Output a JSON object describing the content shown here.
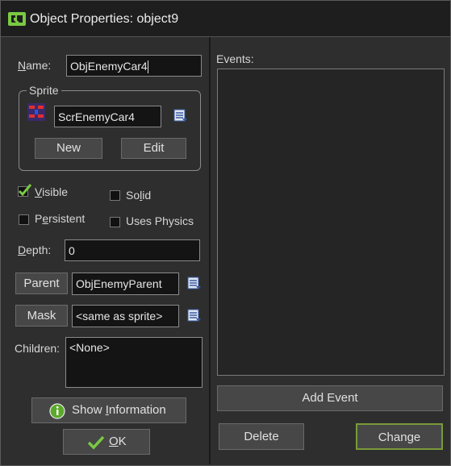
{
  "window": {
    "title": "Object Properties: object9"
  },
  "name": {
    "label": "Name:",
    "label_u": "N",
    "label_rest": "ame:",
    "value": "ObjEnemyCar4"
  },
  "sprite": {
    "legend": "Sprite",
    "value": "ScrEnemyCar4",
    "new_label": "New",
    "edit_label": "Edit"
  },
  "options": {
    "visible": {
      "label_u": "V",
      "label_rest": "isible",
      "checked": true
    },
    "solid": {
      "label_pre": "So",
      "label_u": "l",
      "label_rest": "id",
      "checked": false
    },
    "persistent": {
      "label_pre": "P",
      "label_u": "e",
      "label_rest": "rsistent",
      "checked": false
    },
    "uses_physics": {
      "label": "Uses Physics",
      "checked": false
    }
  },
  "depth": {
    "label_u": "D",
    "label_rest": "epth:",
    "value": "0"
  },
  "parent": {
    "button": "Parent",
    "value": "ObjEnemyParent"
  },
  "mask": {
    "button": "Mask",
    "value": "<same as sprite>"
  },
  "children": {
    "label": "Children:",
    "value": "<None>"
  },
  "show_info": {
    "pre": "Show ",
    "u": "I",
    "rest": "nformation"
  },
  "ok": {
    "u": "O",
    "rest": "K"
  },
  "events": {
    "label": "Events:"
  },
  "buttons": {
    "add_event": "Add Event",
    "delete": "Delete",
    "change": "Change"
  },
  "colors": {
    "accent_green": "#7ac943",
    "window_bg": "#2e2e2e",
    "panel_bg": "#252525"
  }
}
